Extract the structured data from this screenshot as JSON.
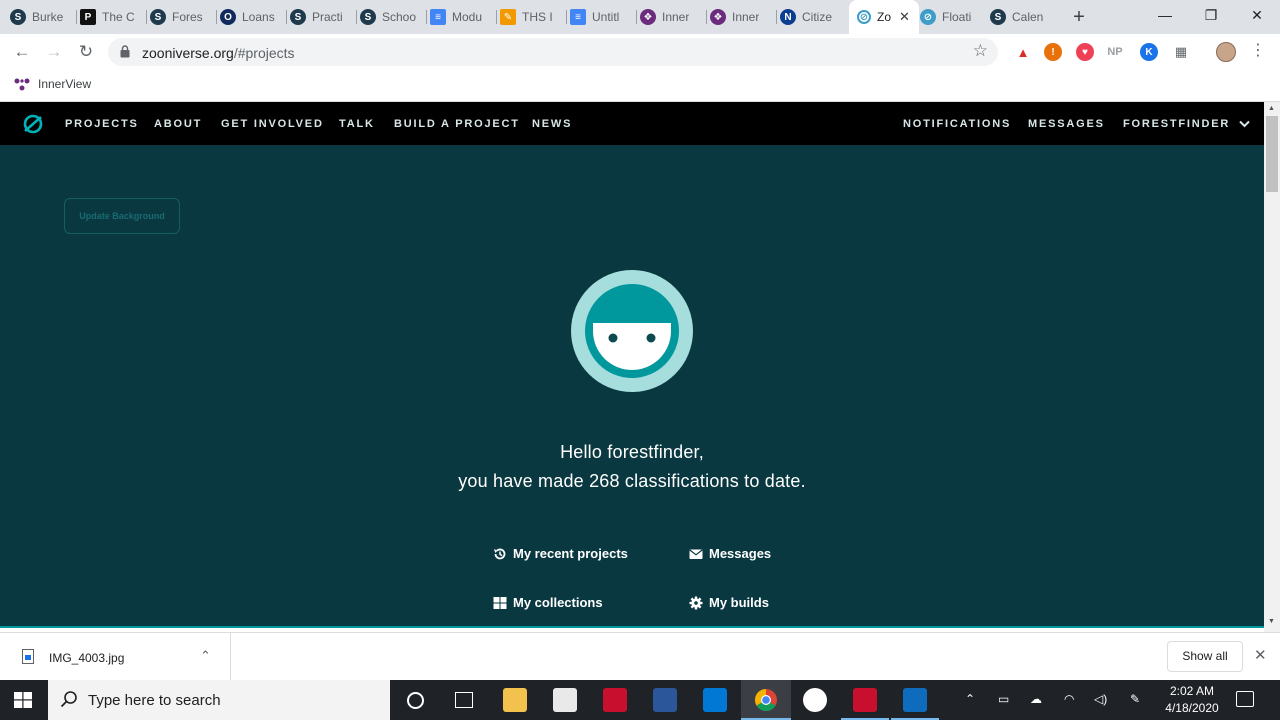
{
  "browser": {
    "tabs": [
      {
        "label": "Burke",
        "icon": "skillshare",
        "color": "#1f3a4d",
        "glyph": "S"
      },
      {
        "label": "The C",
        "icon": "p-logo",
        "color": "#111111",
        "glyph": "P"
      },
      {
        "label": "Fores",
        "icon": "skillshare",
        "color": "#1f3a4d",
        "glyph": "S"
      },
      {
        "label": "Loans",
        "icon": "o-ring",
        "color": "#102a5c",
        "glyph": "O"
      },
      {
        "label": "Practi",
        "icon": "skillshare",
        "color": "#1f3a4d",
        "glyph": "S"
      },
      {
        "label": "Schoo",
        "icon": "skillshare",
        "color": "#1f3a4d",
        "glyph": "S"
      },
      {
        "label": "Modu",
        "icon": "google-docs",
        "color": "#4285f4",
        "glyph": "≡"
      },
      {
        "label": "THS I",
        "icon": "pencil-badge",
        "color": "#f29900",
        "glyph": "✎"
      },
      {
        "label": "Untitl",
        "icon": "google-docs",
        "color": "#4285f4",
        "glyph": "≡"
      },
      {
        "label": "Inner",
        "icon": "innerview",
        "color": "#6b2c7e",
        "glyph": "❖"
      },
      {
        "label": "Inner",
        "icon": "innerview",
        "color": "#6b2c7e",
        "glyph": "❖"
      },
      {
        "label": "Citize",
        "icon": "nasa",
        "color": "#0b3d91",
        "glyph": "N"
      }
    ],
    "active_tab": {
      "label": "Zo",
      "icon": "zooniverse",
      "close": "✕"
    },
    "tabs_after": [
      {
        "label": "Floati",
        "icon": "zooniverse",
        "color": "#3e9dc8",
        "glyph": "⊘"
      },
      {
        "label": "Calen",
        "icon": "skillshare",
        "color": "#1f3a4d",
        "glyph": "S"
      }
    ],
    "url_host": "zooniverse.org",
    "url_path": "/#projects",
    "extensions": [
      {
        "name": "acrobat-icon",
        "color": "#d93025",
        "glyph": "▲"
      },
      {
        "name": "alert-icon",
        "color": "#e8710a",
        "glyph": "!"
      },
      {
        "name": "pocket-icon",
        "color": "#ef4056",
        "glyph": "♥"
      },
      {
        "name": "np-icon",
        "color": "#9aa0a6",
        "glyph": "NP"
      },
      {
        "name": "k-icon",
        "color": "#1a73e8",
        "glyph": "K"
      },
      {
        "name": "grid-icon",
        "color": "#5f6368",
        "glyph": "▦"
      }
    ],
    "bookmark_label": "InnerView"
  },
  "site": {
    "nav_left": [
      "PROJECTS",
      "ABOUT",
      "GET INVOLVED",
      "TALK",
      "BUILD A PROJECT",
      "NEWS"
    ],
    "nav_right": [
      "NOTIFICATIONS",
      "MESSAGES",
      "FORESTFINDER"
    ],
    "update_background": "Update Background",
    "greeting_line1": "Hello forestfinder,",
    "greeting_line2": "you have made 268 classifications to date.",
    "links": {
      "recent": "My recent projects",
      "messages": "Messages",
      "collections": "My collections",
      "builds": "My builds"
    },
    "colors": {
      "background": "#0a3841",
      "nav": "#000000",
      "accent": "#00979d",
      "avatar_ring": "#a6dddd"
    }
  },
  "download": {
    "file": "IMG_4003.jpg",
    "show_all": "Show all"
  },
  "taskbar": {
    "search_placeholder": "Type here to search",
    "time": "2:02 AM",
    "date": "4/18/2020"
  }
}
